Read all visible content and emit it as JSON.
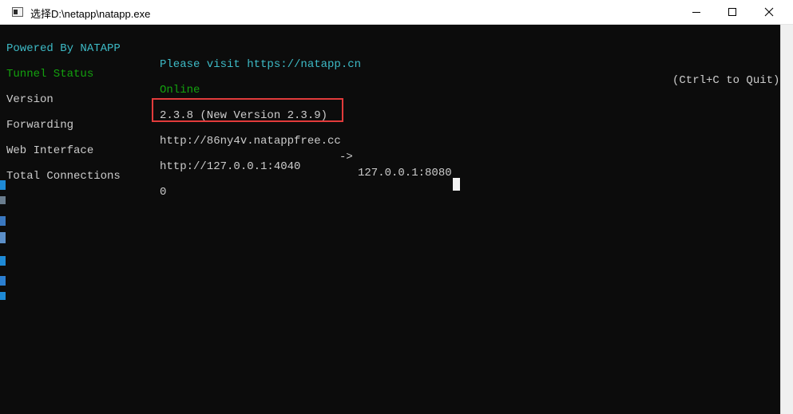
{
  "window": {
    "title": "选择D:\\netapp\\natapp.exe",
    "controls": {
      "minimize": "minimize",
      "maximize": "maximize",
      "close": "close"
    }
  },
  "console": {
    "header": {
      "powered_by": "Powered By NATAPP",
      "visit": "Please visit https://natapp.cn",
      "quit_hint": "(Ctrl+C to Quit)"
    },
    "rows": [
      {
        "label": "Tunnel Status",
        "value": "Online"
      },
      {
        "label": "Version",
        "value": "2.3.8 (New Version 2.3.9)"
      },
      {
        "label": "Forwarding",
        "value": "http://86ny4v.natappfree.cc",
        "arrow": "->",
        "target": "127.0.0.1:8080"
      },
      {
        "label": "Web Interface",
        "value": "http://127.0.0.1:4040"
      },
      {
        "label": "Total Connections",
        "value": "0"
      }
    ]
  },
  "colors": {
    "console_bg": "#0c0c0c",
    "cyan_text": "#3dbbc7",
    "green_text": "#13a10e",
    "default_text": "#cccccc",
    "highlight_border": "#e23b3b"
  }
}
